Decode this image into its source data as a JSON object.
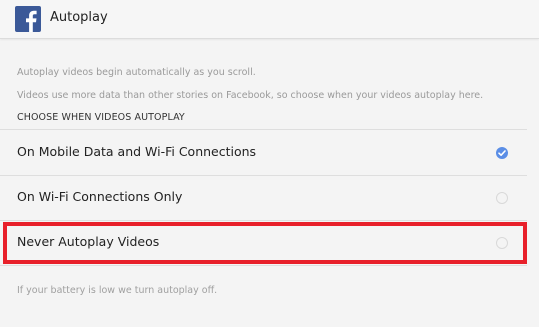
{
  "header": {
    "icon": "facebook-logo-icon",
    "title": "Autoplay"
  },
  "description": {
    "line1": "Autoplay videos begin automatically as you scroll.",
    "line2": "Videos use more data than other stories on Facebook, so choose when your videos autoplay here."
  },
  "section_header": "CHOOSE WHEN VIDEOS AUTOPLAY",
  "options": [
    {
      "label": "On Mobile Data and Wi-Fi Connections",
      "selected": true
    },
    {
      "label": "On Wi-Fi Connections Only",
      "selected": false
    },
    {
      "label": "Never Autoplay Videos",
      "selected": false
    }
  ],
  "footer_note": "If your battery is low we turn autoplay off.",
  "colors": {
    "brand": "#3b5998",
    "checked_radio": "#5b8ee6",
    "highlight": "#e8202a"
  }
}
